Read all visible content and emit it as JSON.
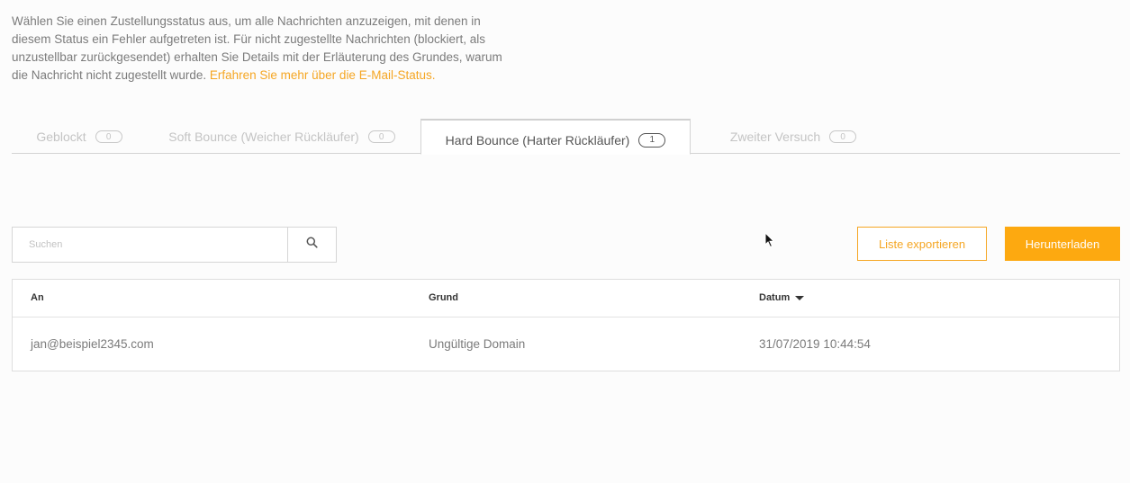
{
  "intro": {
    "text": "Wählen Sie einen Zustellungsstatus aus, um alle Nachrichten anzuzeigen, mit denen in diesem Status ein Fehler aufgetreten ist. Für nicht zugestellte Nachrichten (blockiert, als unzustellbar zurückgesendet) erhalten Sie Details mit der Erläuterung des Grundes, warum die Nachricht nicht zugestellt wurde. ",
    "link": "Erfahren Sie mehr über die E-Mail-Status."
  },
  "tabs": [
    {
      "label": "Geblockt",
      "count": "0"
    },
    {
      "label": "Soft Bounce (Weicher Rückläufer)",
      "count": "0"
    },
    {
      "label": "Hard Bounce (Harter Rückläufer)",
      "count": "1"
    },
    {
      "label": "Zweiter Versuch",
      "count": "0"
    }
  ],
  "search": {
    "placeholder": "Suchen",
    "icon": "search-icon"
  },
  "actions": {
    "export_label": "Liste exportieren",
    "download_label": "Herunterladen"
  },
  "table": {
    "columns": [
      "An",
      "Grund",
      "Datum"
    ],
    "sort_column": "Datum",
    "rows": [
      {
        "to": "jan@beispiel2345.com",
        "reason": "Ungültige Domain",
        "date": "31/07/2019 10:44:54"
      }
    ]
  },
  "colors": {
    "accent": "#f5a623",
    "primary_button": "#fda910"
  }
}
